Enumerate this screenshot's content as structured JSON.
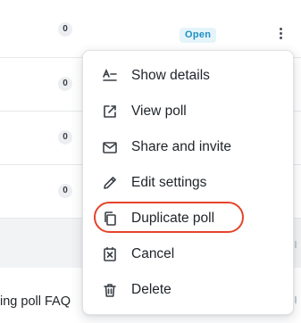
{
  "table": {
    "rows": [
      {
        "count": "0",
        "status": "Open"
      },
      {
        "count": "0"
      },
      {
        "count": "0"
      },
      {
        "count": "0"
      }
    ],
    "partial_row_text": "ing poll FAQ"
  },
  "menu": {
    "items": [
      {
        "label": "Show details",
        "icon": "text-details-icon"
      },
      {
        "label": "View poll",
        "icon": "external-link-icon"
      },
      {
        "label": "Share and invite",
        "icon": "envelope-icon"
      },
      {
        "label": "Edit settings",
        "icon": "pencil-icon"
      },
      {
        "label": "Duplicate poll",
        "icon": "copy-icon"
      },
      {
        "label": "Cancel",
        "icon": "cancel-box-icon"
      },
      {
        "label": "Delete",
        "icon": "trash-icon"
      }
    ],
    "highlighted_item": "Duplicate poll"
  },
  "colors": {
    "status_open_bg": "#e5f4fb",
    "status_open_text": "#1f8fc2",
    "highlight_ring": "#e5432b"
  }
}
